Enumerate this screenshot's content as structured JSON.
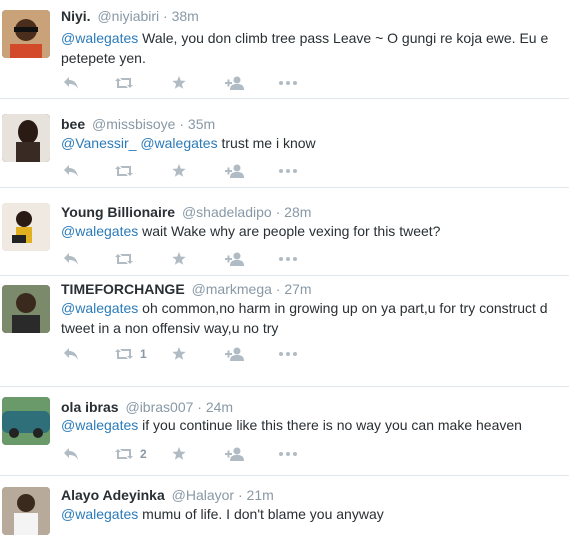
{
  "tweets": [
    {
      "fullname": "Niyi.",
      "username": "@niyiabiri",
      "separator": "·",
      "time": "38m",
      "mentions": [
        "@walegates"
      ],
      "text": "Wale, you don climb tree pass Leave ~ O gungi re koja ewe. Eu e petepete yen.",
      "retweet_count": "",
      "avatar_bg": "#6b4a2a"
    },
    {
      "fullname": "bee",
      "username": "@missbisoye",
      "separator": "·",
      "time": "35m",
      "mentions": [
        "@Vanessir_",
        "@walegates"
      ],
      "text": "trust me i know",
      "retweet_count": "",
      "avatar_bg": "#3c2a26"
    },
    {
      "fullname": "Young Billionaire",
      "username": "@shadeladipo",
      "separator": "·",
      "time": "28m",
      "mentions": [
        "@walegates"
      ],
      "text": "wait Wake why are people vexing for this tweet?",
      "retweet_count": "",
      "avatar_bg": "#d9c8b8"
    },
    {
      "fullname": "TIMEFORCHANGE",
      "username": "@markmega",
      "separator": "·",
      "time": "27m",
      "mentions": [
        "@walegates"
      ],
      "text": "oh common,no harm in growing up on ya part,u for try construct d tweet in a non offensiv way,u no try",
      "retweet_count": "1",
      "avatar_bg": "#4a4a3e"
    },
    {
      "fullname": "ola ibras",
      "username": "@ibras007",
      "separator": "·",
      "time": "24m",
      "mentions": [
        "@walegates"
      ],
      "text": "if you continue like this there is no way you can make heaven",
      "retweet_count": "2",
      "avatar_bg": "#2f6f7a"
    },
    {
      "fullname": "Alayo Adeyinka",
      "username": "@Halayor",
      "separator": "·",
      "time": "21m",
      "mentions": [
        "@walegates"
      ],
      "text": "mumu of life. I don't blame you anyway",
      "retweet_count": "",
      "avatar_bg": "#8a7a6a"
    }
  ],
  "colors": {
    "link": "#2b7bb9",
    "muted": "#8899a6",
    "icon": "#b1bbc3",
    "divider": "#e1e8ed"
  }
}
